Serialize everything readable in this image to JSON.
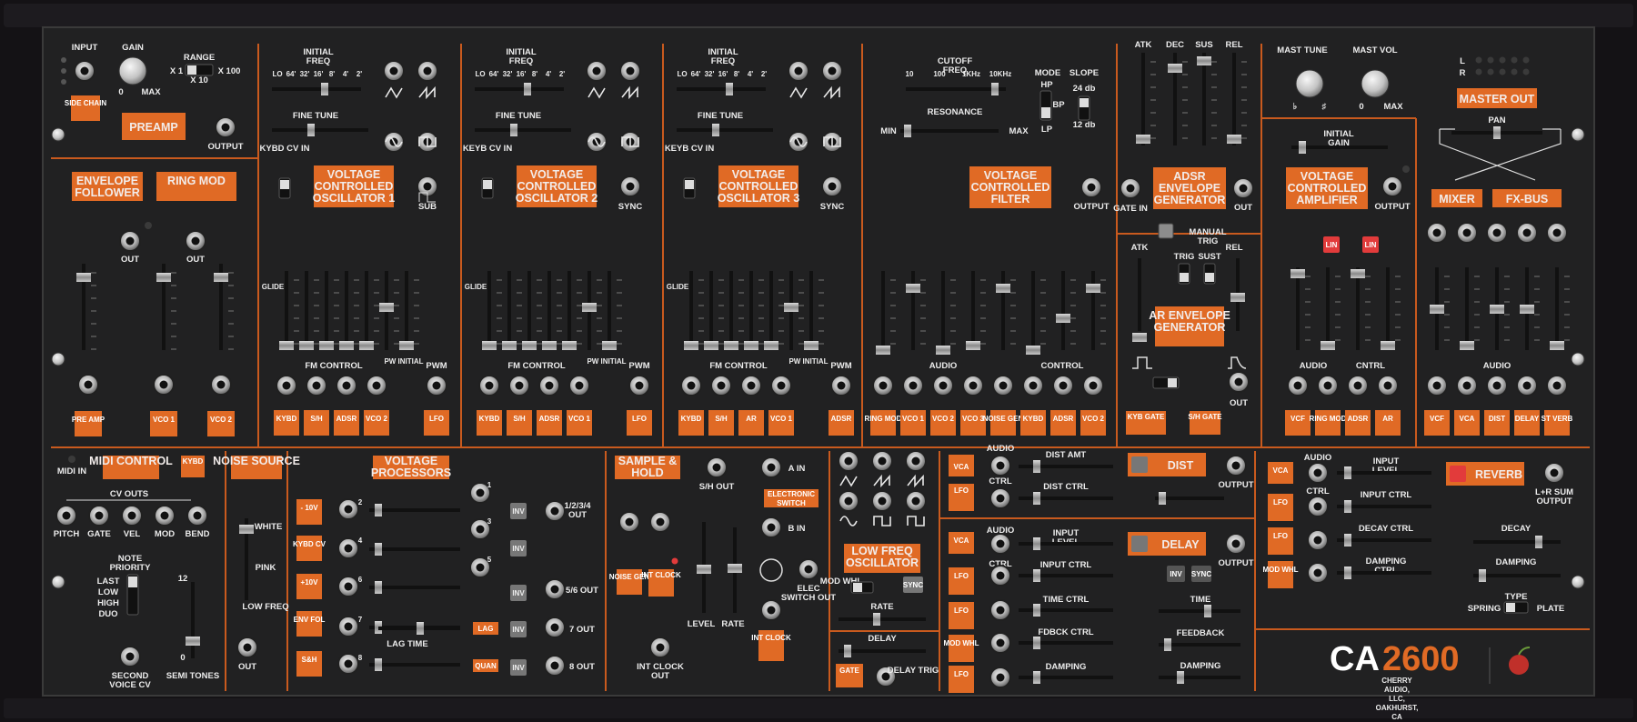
{
  "brand": {
    "model_a": "CA",
    "model_b": "2600",
    "maker": "CHERRY AUDIO, LLC, OAKHURST, CA",
    "logo": "cherry-logo"
  },
  "colors": {
    "panel": "#1f1f20",
    "accent": "#e06a25",
    "line": "#c95a1e",
    "case": "#141215"
  },
  "preamp": {
    "input": "INPUT",
    "gain": "GAIN",
    "gain_min": "0",
    "gain_max": "MAX",
    "range": "RANGE",
    "r1": "X 1",
    "r10": "X 10",
    "r100": "X 100",
    "side_chain": "SIDE CHAIN",
    "button": "PREAMP",
    "output": "OUTPUT"
  },
  "env_follower": "ENVELOPE FOLLOWER",
  "ring_mod": "RING MOD",
  "out": "OUT",
  "env_inputs": [
    "PRE AMP",
    "VCO 1",
    "VCO 2"
  ],
  "vco": [
    {
      "title": "VOLTAGE CONTROLLED OSCILLATOR 1",
      "kybd": "KYBD CV IN",
      "extra": "SUB",
      "fm_inputs": [
        "KYBD",
        "S/H",
        "ADSR",
        "VCO 2"
      ]
    },
    {
      "title": "VOLTAGE CONTROLLED OSCILLATOR 2",
      "kybd": "KEYB CV IN",
      "extra": "SYNC",
      "fm_inputs": [
        "KYBD",
        "S/H",
        "ADSR",
        "VCO 1"
      ]
    },
    {
      "title": "VOLTAGE CONTROLLED OSCILLATOR 3",
      "kybd": "KEYB CV IN",
      "extra": "SYNC",
      "fm_inputs": [
        "KYBD",
        "S/H",
        "AR",
        "VCO 1"
      ]
    }
  ],
  "vco_common": {
    "initial_freq": "INITIAL FREQ",
    "scale": [
      "LO",
      "64'",
      "32'",
      "16'",
      "8'",
      "4'",
      "2'"
    ],
    "fine_tune": "FINE TUNE",
    "glide": "GLIDE",
    "fm_control": "FM CONTROL",
    "pw_initial": "PW INITIAL",
    "pwm": "PWM",
    "pwm_sources": [
      "LFO",
      "LFO",
      "ADSR"
    ]
  },
  "vcf": {
    "cutoff": "CUTOFF FREQ",
    "ticks": [
      "10",
      "100",
      "1KHz",
      "10KHz"
    ],
    "mode": "MODE",
    "hp": "HP",
    "bp": "BP",
    "lp": "LP",
    "slope": "SLOPE",
    "s24": "24 db",
    "s12": "12 db",
    "resonance": "RESONANCE",
    "min": "MIN",
    "max": "MAX",
    "title": "VOLTAGE CONTROLLED FILTER",
    "output": "OUTPUT",
    "audio": "AUDIO",
    "control": "CONTROL",
    "inputs": [
      "RING MOD",
      "VCO 1",
      "VCO 2",
      "VCO 3",
      "NOISE GEN",
      "KYBD",
      "ADSR",
      "VCO 2"
    ]
  },
  "adsr": {
    "labels": [
      "ATK",
      "DEC",
      "SUS",
      "REL"
    ],
    "gate_in": "GATE IN",
    "title": "ADSR ENVELOPE GENERATOR",
    "out": "OUT",
    "manual_trig": "MANUAL TRIG"
  },
  "ar": {
    "atk": "ATK",
    "rel": "REL",
    "trig": "TRIG",
    "sust": "SUST",
    "title": "AR ENVELOPE GENERATOR",
    "kyb_gate": "KYB GATE",
    "sh_gate": "S/H GATE",
    "out": "OUT"
  },
  "vca": {
    "initial_gain": "INITIAL GAIN",
    "title": "VOLTAGE CONTROLLED AMPLIFIER",
    "output": "OUTPUT",
    "lin": "LIN",
    "audio": "AUDIO",
    "cntrl": "CNTRL",
    "inputs": [
      "VCF",
      "RING MOD",
      "ADSR",
      "AR"
    ]
  },
  "master": {
    "tune": "MAST TUNE",
    "vol": "MAST VOL",
    "vol_min": "0",
    "vol_max": "MAX",
    "flat": "♭",
    "sharp": "♯",
    "l": "L",
    "r": "R",
    "out": "MASTER OUT",
    "pan": "PAN",
    "mixer": "MIXER",
    "fxbus": "FX-BUS",
    "audio": "AUDIO",
    "inputs": [
      "VCF",
      "VCA",
      "DIST",
      "DELAY",
      "ST VERB"
    ]
  },
  "midi": {
    "midi_in": "MIDI IN",
    "title": "MIDI CONTROL",
    "kybd": "KYBD",
    "cv_outs": "CV OUTS",
    "outs": [
      "PITCH",
      "GATE",
      "VEL",
      "MOD",
      "BEND"
    ],
    "note_priority": "NOTE PRIORITY",
    "modes": [
      "LAST",
      "LOW",
      "HIGH",
      "DUO"
    ],
    "second_voice": "SECOND VOICE CV",
    "semi_12": "12",
    "semi_0": "0",
    "semi": "SEMI TONES"
  },
  "noise": {
    "title": "NOISE SOURCE",
    "white": "WHITE",
    "pink": "PINK",
    "low": "LOW FREQ",
    "out": "OUT"
  },
  "vp": {
    "title": "VOLTAGE PROCESSORS",
    "sources": [
      "- 10V",
      "KYBD CV",
      "+10V",
      "ENV FOL",
      "S&H"
    ],
    "nums": [
      "1",
      "2",
      "3",
      "4",
      "5",
      "6",
      "7",
      "8"
    ],
    "inv": "INV",
    "o1234": "1/2/3/4 OUT",
    "o56": "5/6 OUT",
    "o7": "7 OUT",
    "o8": "8 OUT",
    "lag_time": "LAG TIME",
    "lag": "LAG",
    "quan": "QUAN"
  },
  "sh": {
    "title": "SAMPLE & HOLD",
    "out": "S/H OUT",
    "noise": "NOISE GEN",
    "clock": "INT CLOCK",
    "level": "LEVEL",
    "rate": "RATE",
    "clock_out": "INT CLOCK OUT",
    "a_in": "A IN",
    "b_in": "B IN",
    "elec": "ELECTRONIC SWITCH",
    "elec_out": "ELEC SWITCH OUT",
    "int_clock": "INT CLOCK"
  },
  "lfo": {
    "title": "LOW FREQ OSCILLATOR",
    "mod_whl": "MOD WHL",
    "sync": "SYNC",
    "rate": "RATE",
    "delay": "DELAY",
    "gate": "GATE",
    "delay_trig": "DELAY TRIG"
  },
  "dist": {
    "vca": "VCA",
    "lfo": "LFO",
    "audio": "AUDIO",
    "ctrl": "CTRL",
    "amt": "DIST AMT",
    "dctrl": "DIST CTRL",
    "title": "DIST",
    "output": "OUTPUT"
  },
  "delay": {
    "vca": "VCA",
    "sources": [
      "LFO",
      "LFO",
      "MOD WHL",
      "LFO"
    ],
    "audio": "AUDIO",
    "ctrl": "CTRL",
    "rows": [
      "INPUT LEVEL",
      "INPUT CTRL",
      "TIME CTRL",
      "FDBCK CTRL",
      "DAMPING"
    ],
    "title": "DELAY",
    "output": "OUTPUT",
    "inv": "INV",
    "sync": "SYNC",
    "time": "TIME",
    "feedback": "FEEDBACK",
    "damping": "DAMPING"
  },
  "reverb": {
    "vca": "VCA",
    "sources": [
      "LFO",
      "LFO",
      "MOD WHL"
    ],
    "audio": "AUDIO",
    "ctrl": "CTRL",
    "rows": [
      "INPUT LEVEL",
      "INPUT CTRL",
      "DECAY CTRL",
      "DAMPING CTRL"
    ],
    "title": "REVERB",
    "output": "L+R SUM OUTPUT",
    "decay": "DECAY",
    "damping": "DAMPING",
    "type": "TYPE",
    "spring": "SPRING",
    "plate": "PLATE"
  }
}
